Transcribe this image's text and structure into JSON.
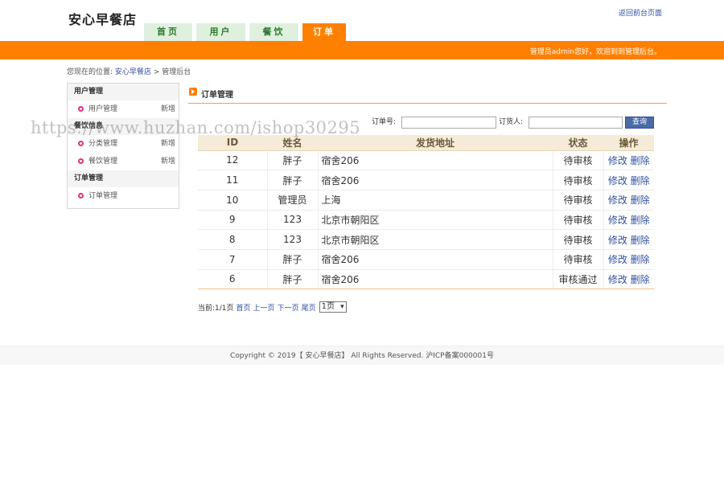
{
  "header": {
    "site_title": "安心早餐店",
    "back_link": "返回前台页面",
    "welcome": "管理员admin您好，欢迎到到管理后台。"
  },
  "nav": {
    "tabs": [
      {
        "label": "首页",
        "active": false
      },
      {
        "label": "用户",
        "active": false
      },
      {
        "label": "餐饮",
        "active": false
      },
      {
        "label": "订单",
        "active": true
      }
    ]
  },
  "breadcrumb": {
    "prefix": "您现在的位置:",
    "link": "安心早餐店",
    "sep": ">",
    "current": "管理后台"
  },
  "sidebar": {
    "groups": [
      {
        "title": "用户管理",
        "items": [
          {
            "label": "用户管理",
            "add": "新增"
          }
        ]
      },
      {
        "title": "餐饮信息",
        "items": [
          {
            "label": "分类管理",
            "add": "新增"
          },
          {
            "label": "餐饮管理",
            "add": "新增"
          }
        ]
      },
      {
        "title": "订单管理",
        "items": [
          {
            "label": "订单管理",
            "add": ""
          }
        ]
      }
    ]
  },
  "main": {
    "section_title": "订单管理",
    "search": {
      "order_no_label": "订单号:",
      "orderer_label": "订货人:",
      "order_no_value": "",
      "orderer_value": "",
      "button": "查询"
    },
    "table": {
      "headers": [
        "ID",
        "姓名",
        "发货地址",
        "状态",
        "操作"
      ],
      "rows": [
        {
          "id": "12",
          "name": "胖子",
          "address": "宿舍206",
          "status": "待审核"
        },
        {
          "id": "11",
          "name": "胖子",
          "address": "宿舍206",
          "status": "待审核"
        },
        {
          "id": "10",
          "name": "管理员",
          "address": "上海",
          "status": "待审核"
        },
        {
          "id": "9",
          "name": "123",
          "address": "北京市朝阳区",
          "status": "待审核"
        },
        {
          "id": "8",
          "name": "123",
          "address": "北京市朝阳区",
          "status": "待审核"
        },
        {
          "id": "7",
          "name": "胖子",
          "address": "宿舍206",
          "status": "待审核"
        },
        {
          "id": "6",
          "name": "胖子",
          "address": "宿舍206",
          "status": "审核通过"
        }
      ],
      "edit_label": "修改",
      "delete_label": "删除"
    },
    "pager": {
      "current": "当前:1/1页",
      "first": "首页",
      "prev": "上一页",
      "next": "下一页",
      "last": "尾页",
      "select_value": "1页"
    }
  },
  "footer": {
    "text": "Copyright © 2019【 安心早餐店】 All Rights Reserved. 沪ICP备案000001号"
  },
  "watermark": "https://www.huzhan.com/ishop30295"
}
